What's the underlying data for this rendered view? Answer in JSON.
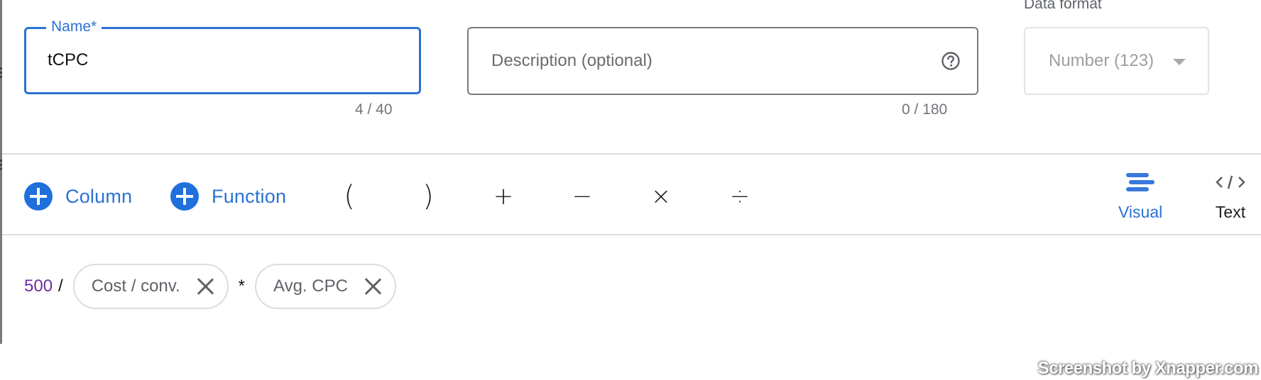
{
  "name_field": {
    "label": "Name*",
    "value": "tCPC",
    "counter": "4 / 40"
  },
  "description_field": {
    "placeholder": "Description (optional)",
    "counter": "0 / 180",
    "help_icon": "help-circle-icon"
  },
  "data_format": {
    "label": "Data format",
    "selected": "Number (123)",
    "icon": "dropdown-arrow-icon"
  },
  "toolbar": {
    "column_label": "Column",
    "function_label": "Function",
    "operators": {
      "open_paren": "(",
      "close_paren": ")",
      "plus": "+",
      "minus": "−",
      "multiply": "×",
      "divide": "÷"
    },
    "modes": [
      {
        "label": "Visual",
        "icon": "visual-lines-icon",
        "active": true
      },
      {
        "label": "Text",
        "icon": "code-icon",
        "active": false
      }
    ]
  },
  "formula": {
    "number": "500",
    "op1": "/",
    "chip1": "Cost / conv.",
    "op2": "*",
    "chip2": "Avg. CPC"
  },
  "colors": {
    "accent": "#2a72d4",
    "number_token": "#6b2fa0"
  },
  "watermark": "Screenshot by Xnapper.com"
}
